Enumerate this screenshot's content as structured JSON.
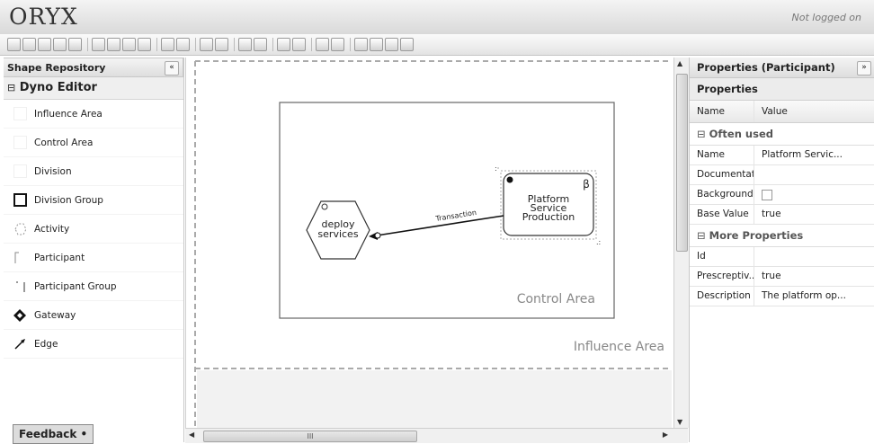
{
  "app": {
    "logo": "ORYX",
    "login_status": "Not logged on"
  },
  "toolbar": {
    "groups": [
      [
        "save-icon",
        "save-as-icon",
        "print-icon",
        "pdf-icon",
        "info-icon"
      ],
      [
        "cut-icon",
        "copy-icon",
        "paste-icon",
        "delete-icon"
      ],
      [
        "undo-icon",
        "redo-icon"
      ],
      [
        "align-icon",
        "align-2-icon"
      ],
      [
        "arrange-icon",
        "layout-icon"
      ],
      [
        "select-icon",
        "deselect-icon"
      ],
      [
        "add-icon",
        "edit-icon"
      ],
      [
        "zoom-in-icon",
        "zoom-out-icon",
        "zoom-fit-icon",
        "zoom-window-icon"
      ]
    ]
  },
  "shape_repository": {
    "title": "Shape Repository",
    "collapse_label": "«",
    "group_title": "Dyno Editor",
    "items": [
      {
        "label": "Influence Area",
        "icon": "area-icon"
      },
      {
        "label": "Control Area",
        "icon": "area-icon"
      },
      {
        "label": "Division",
        "icon": "area-icon"
      },
      {
        "label": "Division Group",
        "icon": "square-icon"
      },
      {
        "label": "Activity",
        "icon": "hexagon-icon"
      },
      {
        "label": "Participant",
        "icon": "bracket-icon"
      },
      {
        "label": "Participant Group",
        "icon": "bracket-pair-icon"
      },
      {
        "label": "Gateway",
        "icon": "diamond-icon"
      },
      {
        "label": "Edge",
        "icon": "arrow-icon"
      }
    ]
  },
  "feedback": {
    "label": "Feedback •"
  },
  "canvas": {
    "influence_area_label": "Influence Area",
    "control_area_label": "Control Area",
    "activity": {
      "line1": "deploy",
      "line2": "services"
    },
    "participant": {
      "line1": "Platform",
      "line2": "Service",
      "line3": "Production",
      "marker": "β"
    },
    "edge_label": "Transaction"
  },
  "properties": {
    "title": "Properties (Participant)",
    "expand_label": "»",
    "subtitle": "Properties",
    "col_name": "Name",
    "col_value": "Value",
    "often_used_label": "Often used",
    "often_used": [
      {
        "name": "Name",
        "value": "Platform Servic..."
      },
      {
        "name": "Documentati...",
        "value": ""
      },
      {
        "name": "Background...",
        "value": "",
        "checkbox": true
      },
      {
        "name": "Base Value",
        "value": "true"
      }
    ],
    "more_label": "More Properties",
    "more": [
      {
        "name": "Id",
        "value": ""
      },
      {
        "name": "Prescreptiv...",
        "value": "true"
      },
      {
        "name": "Description",
        "value": "The platform op..."
      }
    ]
  },
  "scrollbar": {
    "h_grip": "III"
  }
}
